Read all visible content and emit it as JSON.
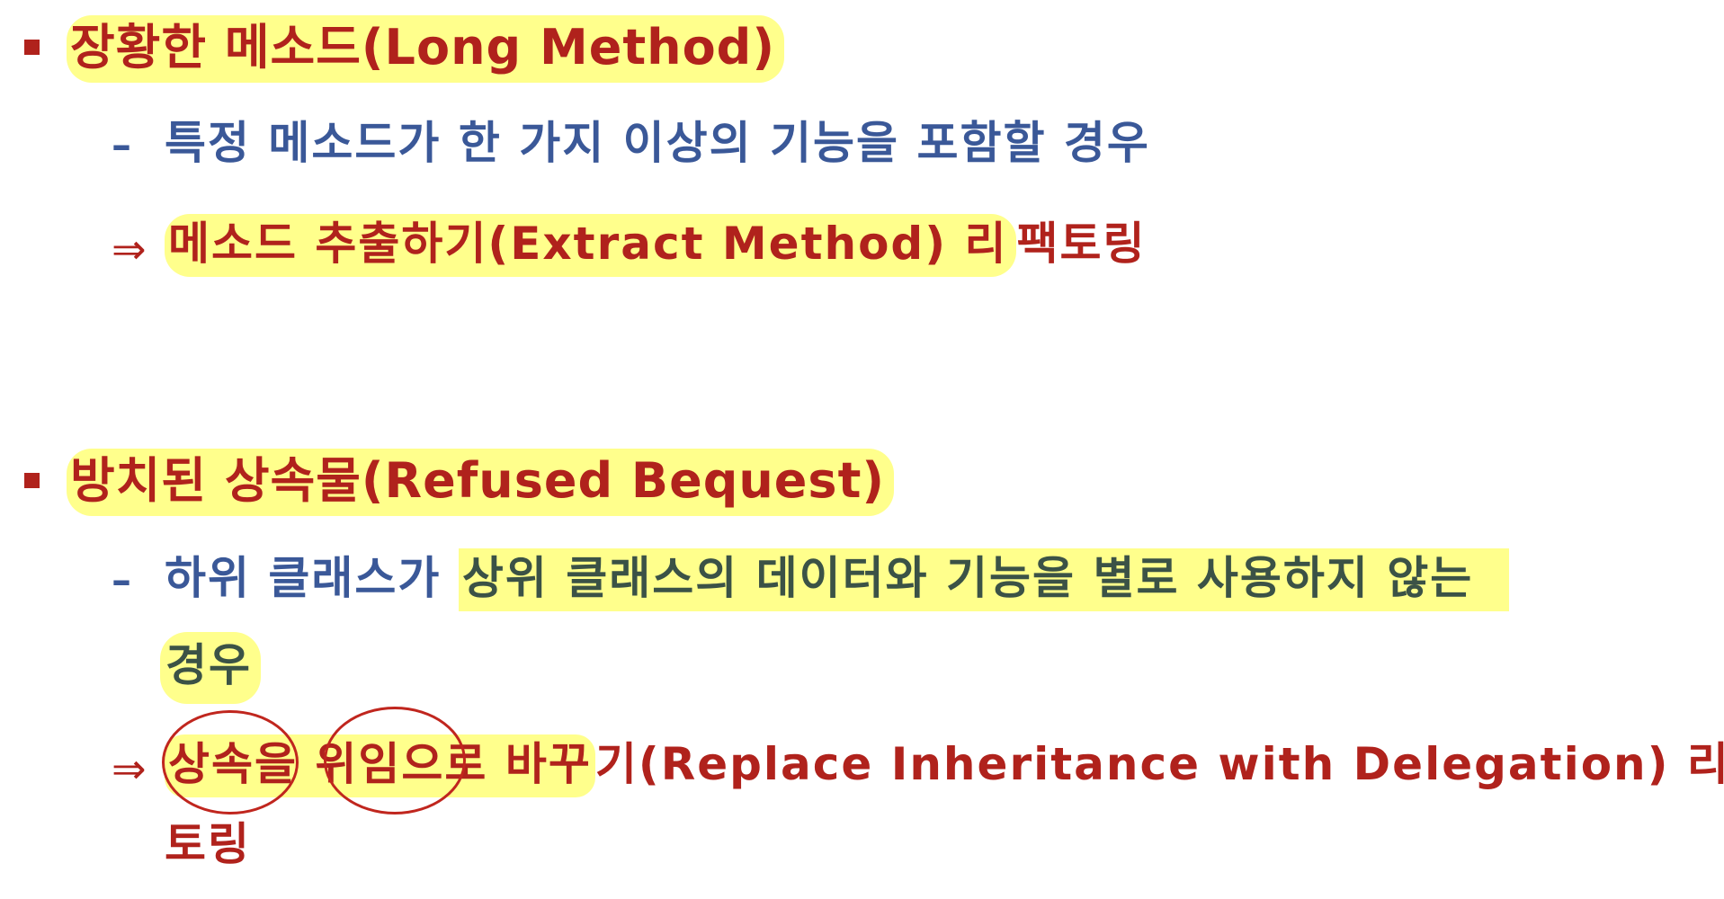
{
  "sections": [
    {
      "title": "장황한 메소드(Long Method)",
      "description": "특정 메소드가 한 가지 이상의 기능을 포함할 경우",
      "refactoring_highlighted": "메소드 추출하기(Extract Method) 리",
      "refactoring_rest": "팩토링"
    },
    {
      "title": "방치된 상속물(Refused Bequest)",
      "description_plain": "하위 클래스가 ",
      "description_highlighted": "상위 클래스의 데이터와 기능을 별로 사용하지 않는",
      "description_wrap": "경우",
      "refactoring_word1": "상속",
      "refactoring_word1_rest": "을 ",
      "refactoring_word2": "위임",
      "refactoring_word2_rest": "으로 바꾸",
      "refactoring_rest": "기(Replace Inheritance with Delegation) 리팩",
      "refactoring_wrap": "토링"
    }
  ],
  "symbols": {
    "dash": "–",
    "arrow": "⇒"
  },
  "colors": {
    "title": "#b0221c",
    "body": "#3a5898",
    "highlight": "#ffff8c"
  }
}
